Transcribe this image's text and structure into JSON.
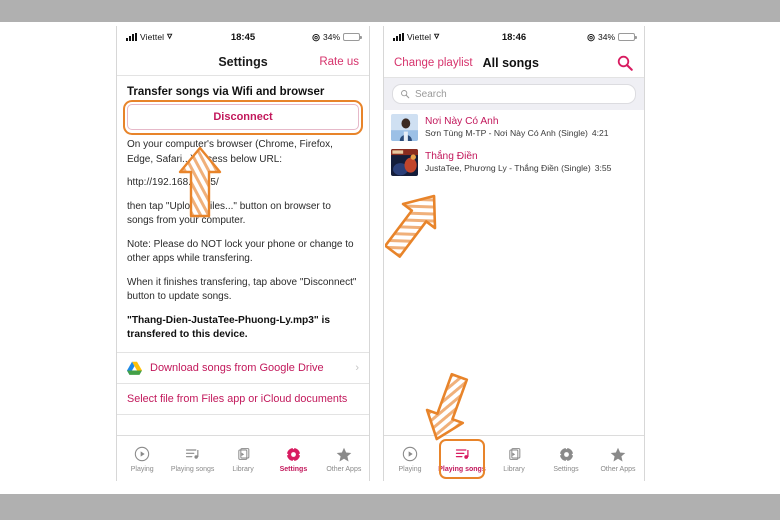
{
  "left_phone": {
    "status_bar": {
      "carrier": "Viettel",
      "time": "18:45",
      "battery_percent": "34%",
      "wifi_icon": "wifi-icon",
      "signal_icon": "cellular-bars-icon",
      "location_icon": "location-arrow-icon",
      "battery_icon": "battery-icon"
    },
    "nav": {
      "title": "Settings",
      "right_action": "Rate us"
    },
    "section_heading": "Transfer songs via Wifi and browser",
    "disconnect_button": "Disconnect",
    "paragraphs": [
      "On your computer's browser (Chrome, Firefox, Edge, Safari...) access below URL:",
      "http://192.168.1.105/",
      "then tap \"Upload Files...\" button on browser to songs from your computer.",
      "Note: Please do NOT lock your phone or change to other apps while transfering.",
      "When it finishes transfering, tap above \"Disconnect\" button to update songs."
    ],
    "transfer_status": "\"Thang-Dien-JustaTee-Phuong-Ly.mp3\" is transfered to this device.",
    "google_drive_row": {
      "label": "Download songs from Google Drive",
      "chevron": "›",
      "icon": "google-drive-icon"
    },
    "files_row": "Select file from Files app or iCloud documents",
    "tabs": [
      {
        "label": "Playing",
        "icon": "play-circle-icon",
        "active": false
      },
      {
        "label": "Playing songs",
        "icon": "playlist-note-icon",
        "active": false
      },
      {
        "label": "Library",
        "icon": "library-stack-icon",
        "active": false
      },
      {
        "label": "Settings",
        "icon": "gear-icon",
        "active": true
      },
      {
        "label": "Other Apps",
        "icon": "star-icon",
        "active": false
      }
    ]
  },
  "right_phone": {
    "status_bar": {
      "carrier": "Viettel",
      "time": "18:46",
      "battery_percent": "34%"
    },
    "nav": {
      "left_action": "Change playlist",
      "title": "All songs",
      "search_icon": "search-icon"
    },
    "search": {
      "placeholder": "Search",
      "value": "",
      "icon": "search-icon"
    },
    "songs": [
      {
        "title": "Nơi Này Có Anh",
        "subtitle": "Sơn Tùng M-TP - Nơi Này Có Anh (Single)",
        "duration": "4:21"
      },
      {
        "title": "Thắng Điền",
        "subtitle": "JustaTee, Phương Ly - Thắng Điền (Single)",
        "duration": "3:55"
      }
    ],
    "tabs": [
      {
        "label": "Playing",
        "icon": "play-circle-icon",
        "active": false
      },
      {
        "label": "Playing songs",
        "icon": "playlist-note-icon",
        "active": true
      },
      {
        "label": "Library",
        "icon": "library-stack-icon",
        "active": false
      },
      {
        "label": "Settings",
        "icon": "gear-icon",
        "active": false
      },
      {
        "label": "Other Apps",
        "icon": "star-icon",
        "active": false
      }
    ]
  },
  "annotations": {
    "highlight_disconnect": "orange-highlight-box",
    "highlight_playing_songs_tab": "orange-highlight-box",
    "arrow_left": "orange-arrow-up",
    "arrow_right_top": "orange-arrow-up-right",
    "arrow_right_bottom": "orange-arrow-down-left"
  },
  "colors": {
    "accent_pink": "#c2185b",
    "highlight_orange": "#e8842a",
    "battery_yellow": "#f5c23b",
    "band_gray": "#b0b0b0",
    "search_bg": "#efeff4"
  }
}
